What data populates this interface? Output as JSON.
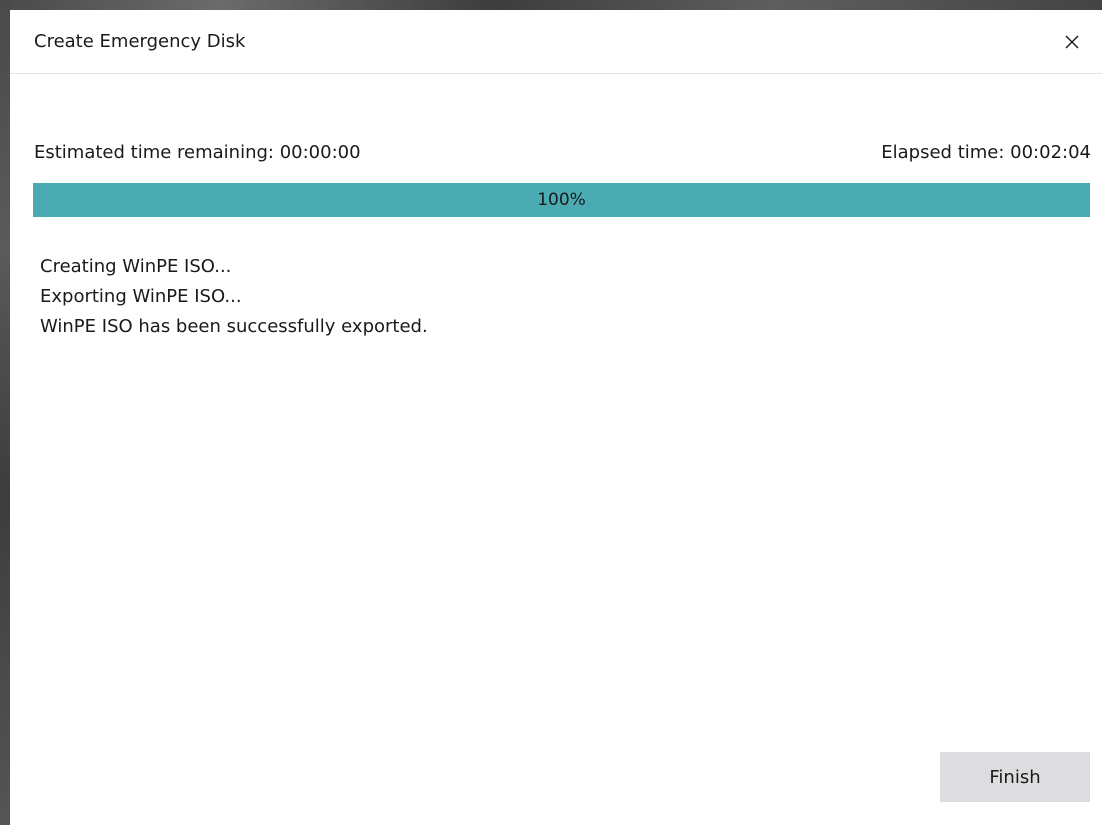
{
  "window": {
    "title": "Create Emergency Disk",
    "close_icon": "close-icon"
  },
  "status": {
    "estimated_label": "Estimated time remaining: 00:00:00",
    "elapsed_label": "Elapsed time: 00:02:04"
  },
  "progress": {
    "value": 1.0,
    "label": "100%",
    "fill_color": "#4aabb3"
  },
  "log": {
    "lines": [
      "Creating WinPE ISO...",
      "Exporting WinPE ISO...",
      "WinPE ISO has been successfully exported."
    ]
  },
  "buttons": {
    "finish_label": "Finish"
  }
}
